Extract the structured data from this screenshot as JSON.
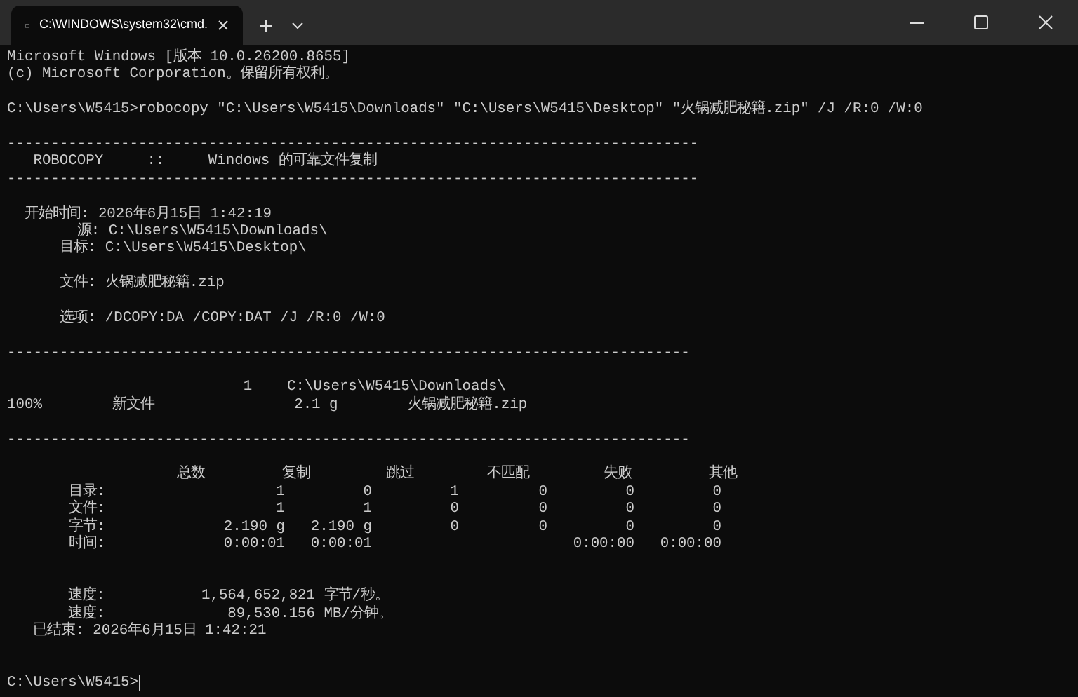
{
  "window": {
    "tab_title": "C:\\WINDOWS\\system32\\cmd."
  },
  "output": [
    {
      "kind": "line",
      "text": "Microsoft Windows [版本 10.0.26200.8655]"
    },
    {
      "kind": "line",
      "text": "(c) Microsoft Corporation。保留所有权利。"
    },
    {
      "kind": "blank"
    },
    {
      "kind": "line",
      "text": "C:\\Users\\W5415>robocopy \"C:\\Users\\W5415\\Downloads\" \"C:\\Users\\W5415\\Desktop\" \"火锅减肥秘籍.zip\" /J /R:0 /W:0"
    },
    {
      "kind": "blank"
    },
    {
      "kind": "line",
      "text": "-------------------------------------------------------------------------------"
    },
    {
      "kind": "line",
      "text": "   ROBOCOPY     ::     Windows 的可靠文件复制"
    },
    {
      "kind": "line",
      "text": "-------------------------------------------------------------------------------"
    },
    {
      "kind": "blank"
    },
    {
      "kind": "line",
      "text": "  开始时间: 2026年6月15日 1:42:19"
    },
    {
      "kind": "line",
      "text": "        源: C:\\Users\\W5415\\Downloads\\"
    },
    {
      "kind": "line",
      "text": "      目标: C:\\Users\\W5415\\Desktop\\"
    },
    {
      "kind": "blank"
    },
    {
      "kind": "line",
      "text": "      文件: 火锅减肥秘籍.zip"
    },
    {
      "kind": "blank"
    },
    {
      "kind": "line",
      "text": "      选项: /DCOPY:DA /COPY:DAT /J /R:0 /W:0"
    },
    {
      "kind": "blank"
    },
    {
      "kind": "line",
      "text": "------------------------------------------------------------------------------"
    },
    {
      "kind": "blank"
    },
    {
      "kind": "line",
      "text": "                           1    C:\\Users\\W5415\\Downloads\\"
    },
    {
      "kind": "line",
      "text": "100%        新文件                2.1 g        火锅减肥秘籍.zip"
    },
    {
      "kind": "blank"
    },
    {
      "kind": "line",
      "text": "------------------------------------------------------------------------------"
    },
    {
      "kind": "blank"
    },
    {
      "kind": "table",
      "columns": [
        "总数",
        "复制",
        "跳过",
        "不匹配",
        "失败",
        "其他"
      ],
      "rows": [
        {
          "label": "目录:",
          "cells": [
            "1",
            "0",
            "1",
            "0",
            "0",
            "0"
          ]
        },
        {
          "label": "文件:",
          "cells": [
            "1",
            "1",
            "0",
            "0",
            "0",
            "0"
          ]
        },
        {
          "label": "字节:",
          "cells": [
            "2.190 g",
            "2.190 g",
            "0",
            "0",
            "0",
            "0"
          ]
        },
        {
          "label": "时间:",
          "cells": [
            "0:00:01",
            "0:00:01",
            null,
            null,
            "0:00:00",
            "0:00:00"
          ]
        }
      ]
    },
    {
      "kind": "blank"
    },
    {
      "kind": "blank"
    },
    {
      "kind": "line",
      "text": "       速度:           1,564,652,821 字节/秒。"
    },
    {
      "kind": "line",
      "text": "       速度:              89,530.156 MB/分钟。"
    },
    {
      "kind": "line",
      "text": "   已结束: 2026年6月15日 1:42:21"
    },
    {
      "kind": "blank"
    },
    {
      "kind": "blank"
    },
    {
      "kind": "prompt",
      "text": "C:\\Users\\W5415>"
    }
  ]
}
